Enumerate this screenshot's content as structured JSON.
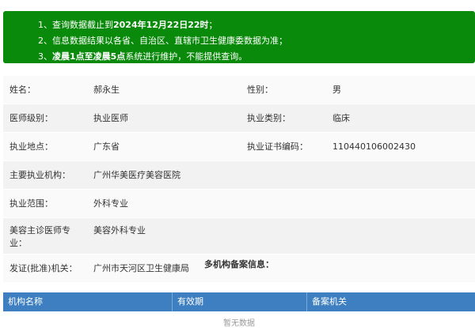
{
  "notice": {
    "line1_prefix": "1、查询数据截止到",
    "line1_bold": "2024年12月22日22时",
    "line1_suffix": "；",
    "line2": "2、信息数据结果以各省、自治区、直辖市卫生健康委数据为准；",
    "line3_prefix": "3、",
    "line3_bold": "凌晨1点至凌晨5点",
    "line3_suffix": "系统进行维护，不能提供查询。",
    "bg_color": "#0a8a0a"
  },
  "info": {
    "name_label": "姓名：",
    "name_value": "郝永生",
    "gender_label": "性别：",
    "gender_value": "男",
    "level_label": "医师级别：",
    "level_value": "执业医师",
    "type_label": "执业类别：",
    "type_value": "临床",
    "location_label": "执业地点：",
    "location_value": "广东省",
    "cert_label": "执业证书编码：",
    "cert_value": "110440106002430",
    "org_label": "主要执业机构：",
    "org_value": "广州华美医疗美容医院",
    "scope_label": "执业范围：",
    "scope_value": "外科专业",
    "specialty_label": "美容主诊医师专业：",
    "specialty_value": "美容外科专业",
    "issuer_label": "发证(批准)机关：",
    "issuer_value": "广州市天河区卫生健康局"
  },
  "multi": {
    "title": "多机构备案信息：",
    "columns": [
      "机构名称",
      "有效期",
      "备案机关"
    ],
    "empty_text": "暂无数据",
    "header_color": "#3d7fc1"
  }
}
